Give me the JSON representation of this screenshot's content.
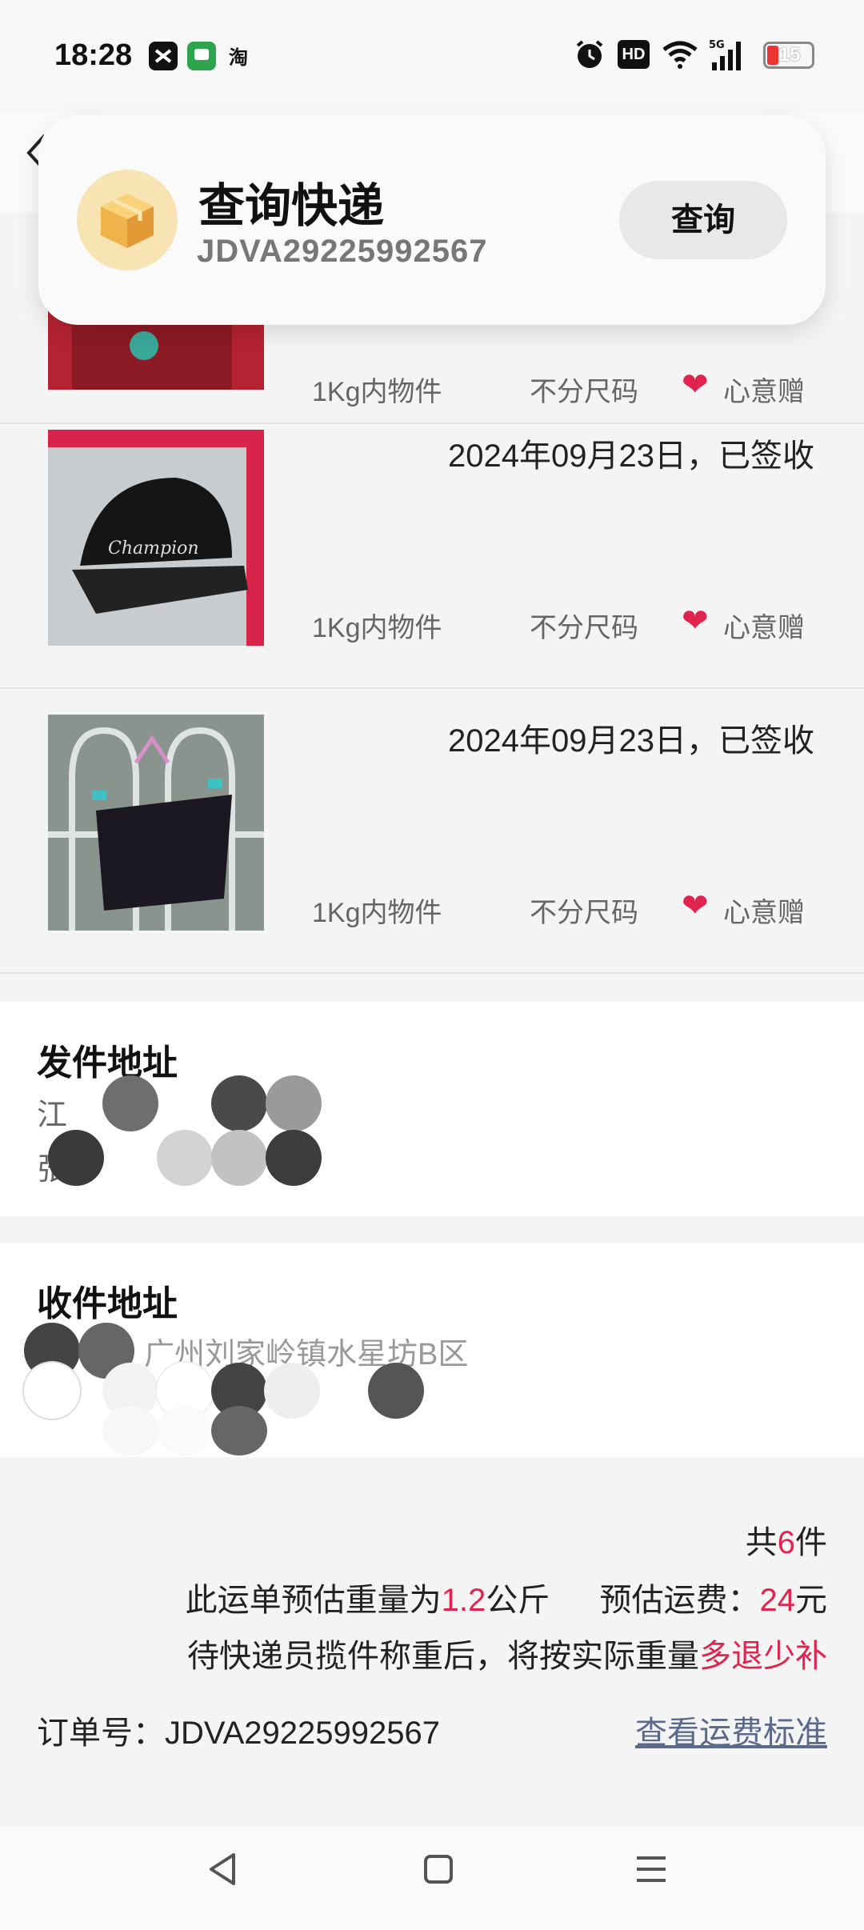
{
  "status_bar": {
    "time": "18:28",
    "hd_badge": "HD",
    "network": "5G",
    "battery": "15"
  },
  "popup": {
    "title": "查询快递",
    "tracking_number": "JDVA29225992567",
    "button_label": "查询",
    "icon": "package-box-icon"
  },
  "items": [
    {
      "date": "",
      "weight": "1Kg内物件",
      "size": "不分尺码",
      "tag": "心意赠"
    },
    {
      "date": "2024年09月23日，已签收",
      "weight": "1Kg内物件",
      "size": "不分尺码",
      "tag": "心意赠"
    },
    {
      "date": "2024年09月23日，已签收",
      "weight": "1Kg内物件",
      "size": "不分尺码",
      "tag": "心意赠"
    }
  ],
  "sender": {
    "title": "发件地址",
    "line1_visible": "江",
    "line1_tail": "**",
    "line2_visible": "张"
  },
  "receiver": {
    "title": "收件地址",
    "line1_visible": "广州刘家岭镇水星坊B区"
  },
  "summary": {
    "count_prefix": "共",
    "count": "6",
    "count_suffix": "件",
    "weight_prefix": "此运单预估重量为",
    "weight_value": "1.2",
    "weight_unit": "公斤",
    "fee_label": "预估运费：",
    "fee_value": "24",
    "fee_unit": "元",
    "note_prefix": "待快递员揽件称重后，将按实际重量",
    "note_highlight": "多退少补",
    "order_label": "订单号：JDVA29225992567",
    "rate_link": "查看运费标准"
  },
  "navbar": {
    "back": "◁",
    "home": "▢",
    "menu": "☰"
  },
  "colors": {
    "accent": "#e0244e",
    "link": "#5b6a8a",
    "background": "#f4f4f5"
  }
}
